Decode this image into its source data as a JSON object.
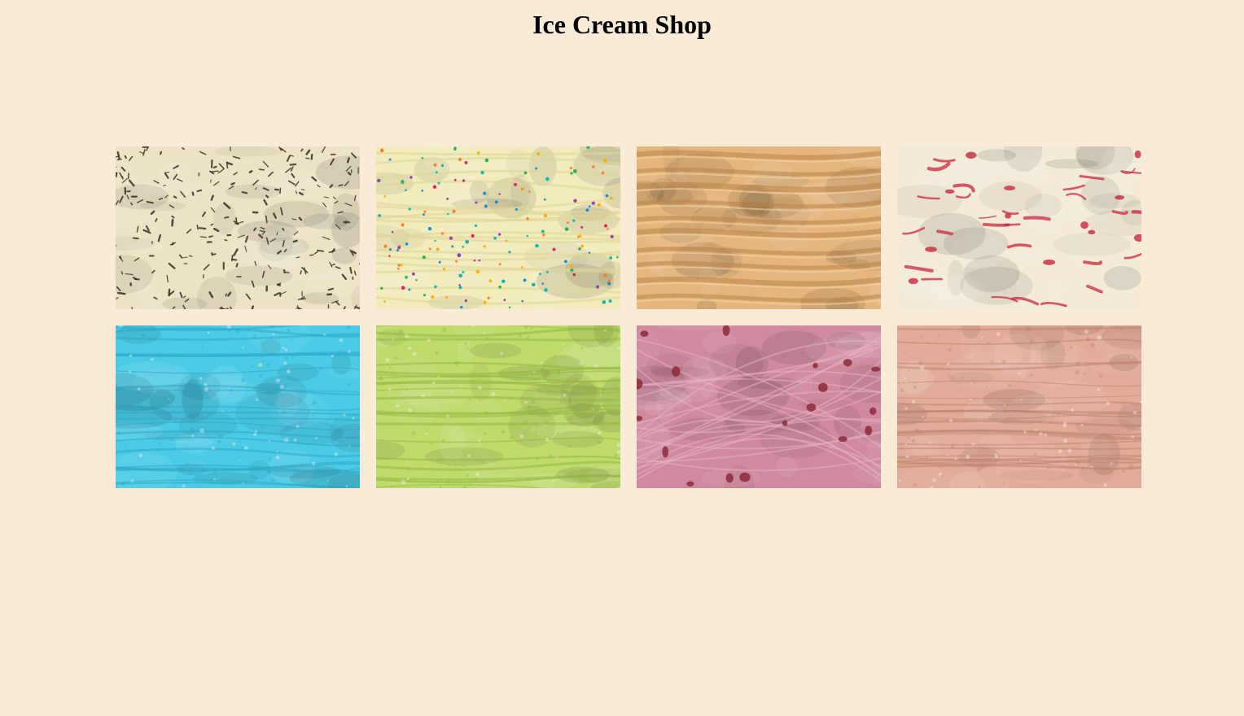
{
  "header": {
    "title": "Ice Cream Shop"
  },
  "flavors": [
    {
      "image": "chocolate-chip-ice-cream-image",
      "base": "#ece3c6",
      "accent": "#3e2f22",
      "texture": "chips"
    },
    {
      "image": "sprinkles-ice-cream-image",
      "base": "#f2ecbd",
      "accent": "#e0d59a",
      "texture": "sprinkles"
    },
    {
      "image": "caramel-ice-cream-image",
      "base": "#e4b57c",
      "accent": "#b98348",
      "texture": "swirl"
    },
    {
      "image": "strawberry-swirl-ice-cream-image",
      "base": "#f3ebd7",
      "accent": "#c8283f",
      "texture": "streaks"
    },
    {
      "image": "blue-ice-cream-image",
      "base": "#4ccbe6",
      "accent": "#2aa6c6",
      "texture": "ripple"
    },
    {
      "image": "pistachio-ice-cream-image",
      "base": "#bedb6c",
      "accent": "#8fb43c",
      "texture": "ripple"
    },
    {
      "image": "cherry-ice-cream-image",
      "base": "#d08aa0",
      "accent": "#8b2a3c",
      "texture": "chunks"
    },
    {
      "image": "peach-ice-cream-image",
      "base": "#e2ab97",
      "accent": "#b97f6c",
      "texture": "ripple"
    }
  ]
}
